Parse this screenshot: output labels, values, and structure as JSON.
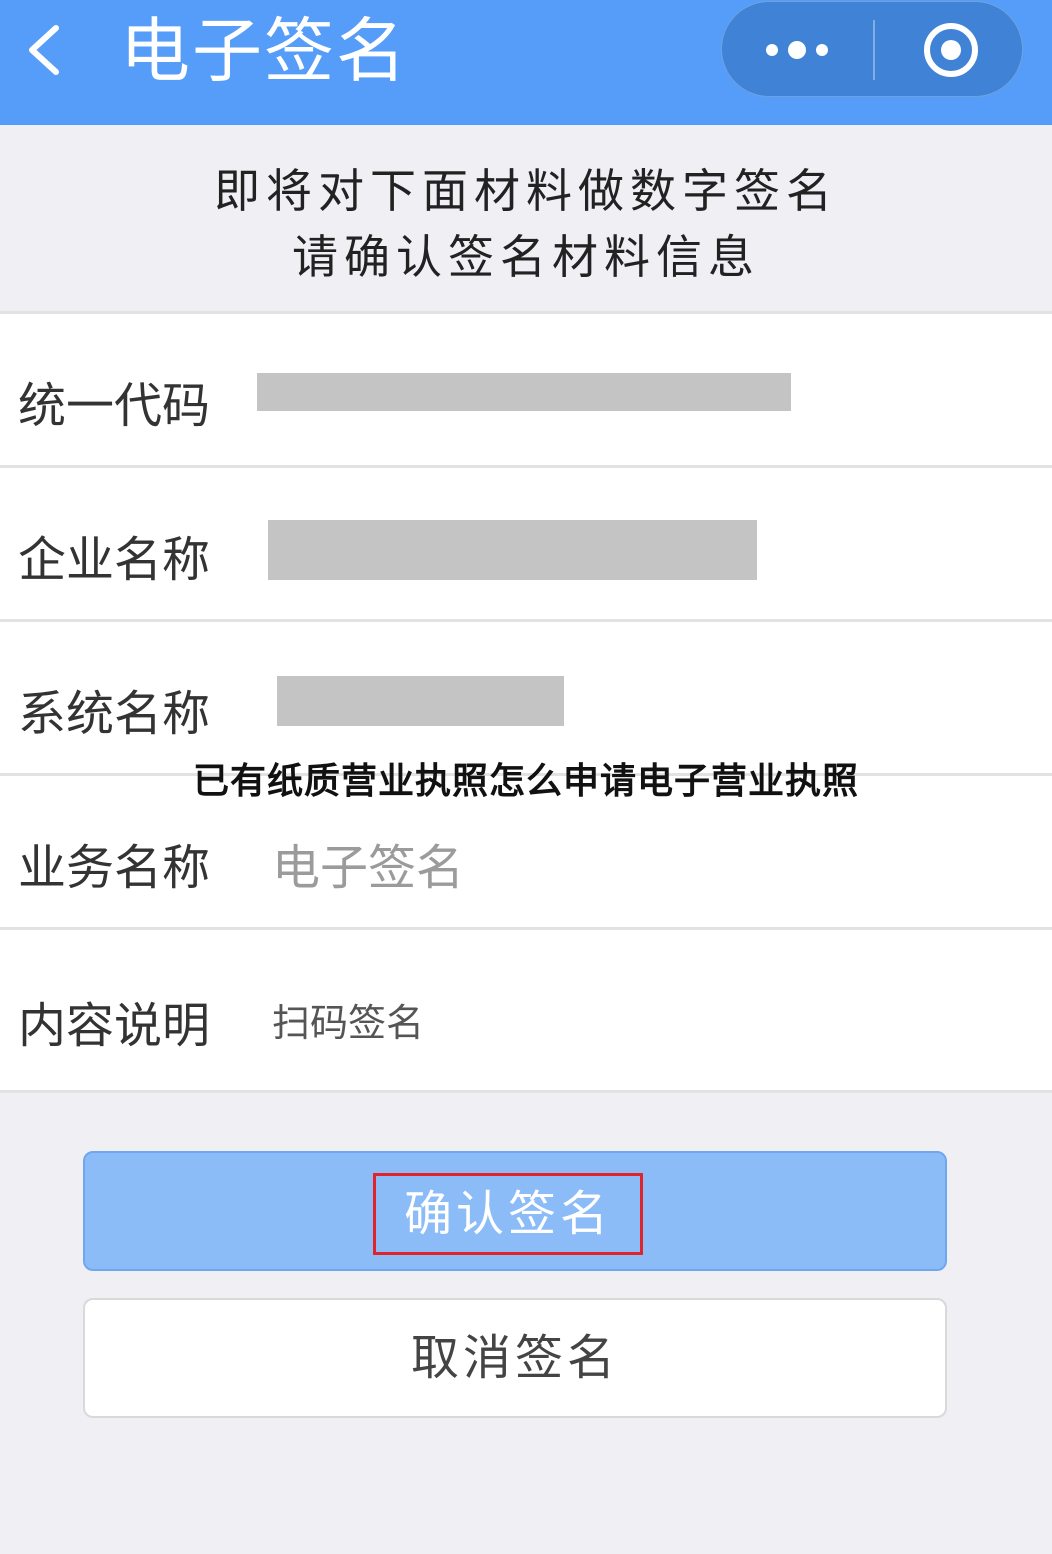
{
  "navbar": {
    "title": "电子签名",
    "back_icon": "chevron-left-icon",
    "more_icon": "more-dots-icon",
    "close_icon": "target-close-icon",
    "background_color": "#559df8"
  },
  "notice": {
    "line1": "即将对下面材料做数字签名",
    "line2": "请确认签名材料信息"
  },
  "form": {
    "rows": [
      {
        "label": "统一代码",
        "value": ""
      },
      {
        "label": "企业名称",
        "value": ""
      },
      {
        "label": "系统名称",
        "value": ""
      },
      {
        "label": "业务名称",
        "value": "电子签名"
      },
      {
        "label": "内容说明",
        "value": "扫码签名"
      }
    ]
  },
  "overlay_title": "已有纸质营业执照怎么申请电子营业执照",
  "actions": {
    "confirm_label": "确认签名",
    "cancel_label": "取消签名",
    "confirm_color": "#8bbcf7",
    "highlight_color": "#e0242c"
  }
}
